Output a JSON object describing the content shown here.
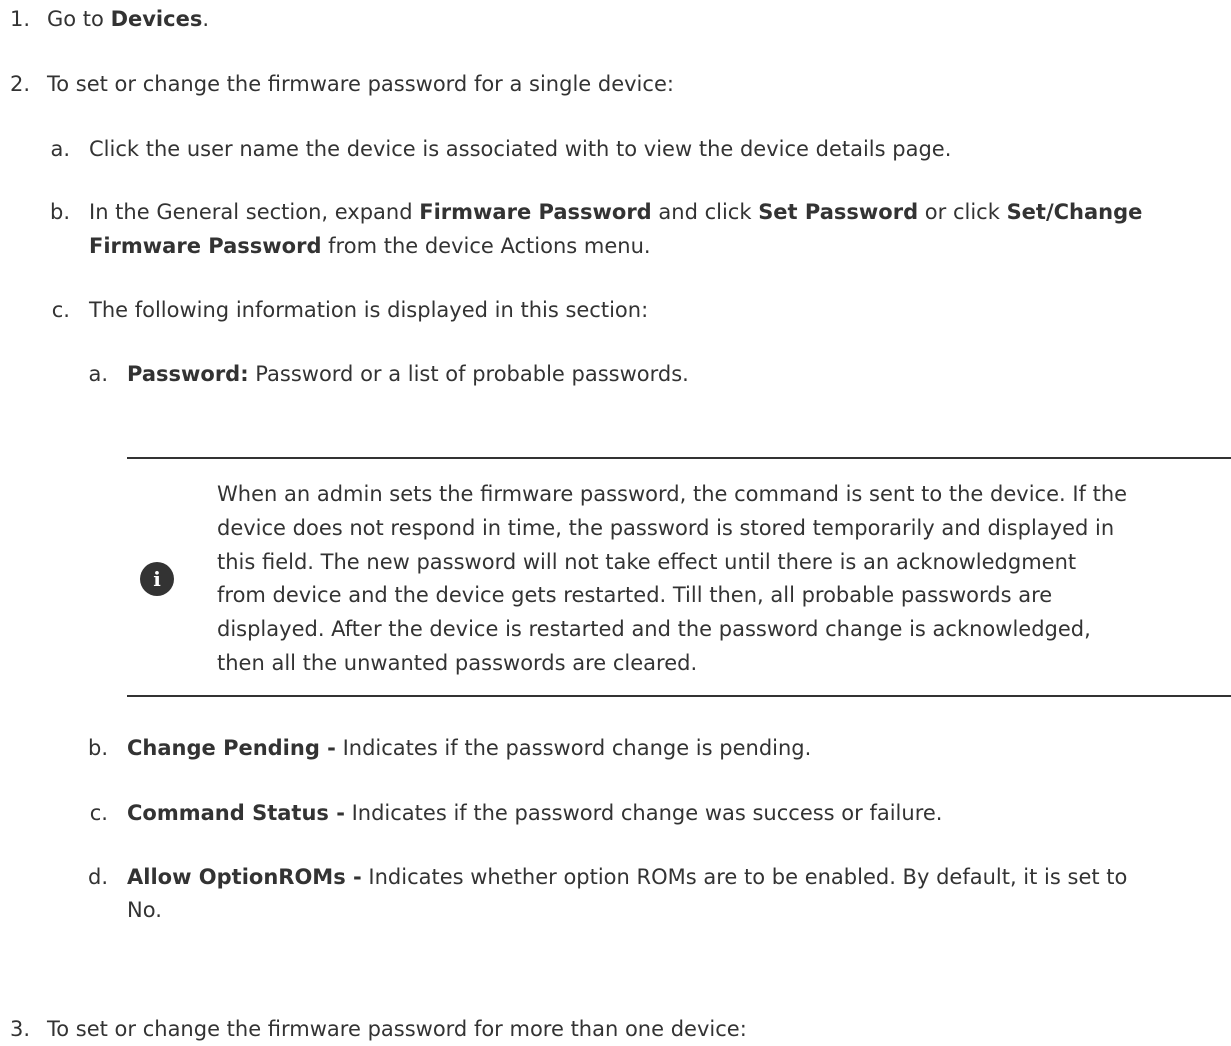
{
  "steps": [
    {
      "marker": "1.",
      "pre": "Go to ",
      "bold": "Devices",
      "post": "."
    },
    {
      "marker": "2.",
      "text": "To set or change the firmware password for a single device:"
    },
    {
      "marker": "3.",
      "text": "To set or change the firmware password for more than one device:"
    }
  ],
  "substeps": {
    "a": {
      "marker": "a.",
      "text": "Click the user name the device is associated with to view the device details page."
    },
    "b": {
      "marker": "b.",
      "l1_pre": "In the General section, expand ",
      "l1_bold1": "Firmware Password",
      "l1_mid": " and click ",
      "l1_bold2": "Set Password",
      "l1_mid2": " or click ",
      "l1_bold3": "Set/Change",
      "l2_bold": "Firmware Password",
      "l2_post": "  from the device Actions menu."
    },
    "c": {
      "marker": "c.",
      "text": "The following information is displayed in this section:"
    }
  },
  "info_items": [
    {
      "marker": "a.",
      "label": "Password:",
      "desc": " Password or a list of probable passwords."
    },
    {
      "marker": "b.",
      "label": "Change Pending -",
      "desc": " Indicates if the password change is pending."
    },
    {
      "marker": "c.",
      "label": "Command Status -",
      "desc": "  Indicates if the password change was success or failure."
    },
    {
      "marker": "d.",
      "label": "Allow OptionROMs -",
      "desc": " Indicates whether option ROMs are to be enabled. By default, it is set to",
      "desc_cont": "No."
    }
  ],
  "note": {
    "icon": "info-icon",
    "icon_glyph": "i",
    "lines": [
      "When an admin sets the firmware password, the command is sent to the device. If the",
      "device does not respond in time, the password is stored temporarily and displayed in",
      "this field. The new password will not take effect until there is an acknowledgment",
      "from device and the device gets restarted. Till then, all probable passwords are",
      "displayed. After the device is restarted and the password change is acknowledged,",
      "then all the unwanted passwords are cleared."
    ]
  }
}
